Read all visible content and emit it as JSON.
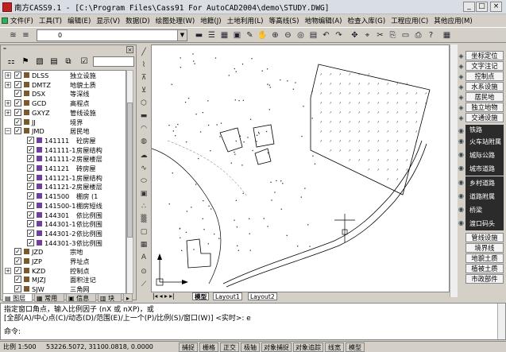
{
  "title": "南方CASS9.1 - [C:\\Program Files\\Cass91 For AutoCAD2004\\demo\\STUDY.DWG]",
  "window_controls": [
    "_",
    "□",
    "×"
  ],
  "menu": [
    "文件(F)",
    "工具(T)",
    "编辑(E)",
    "显示(V)",
    "数据(D)",
    "绘图处理(W)",
    "地籍(J)",
    "土地利用(L)",
    "等高线(S)",
    "地物编辑(A)",
    "检查入库(G)",
    "工程应用(C)",
    "其他应用(M)"
  ],
  "layer_control": {
    "value": "0"
  },
  "tree": [
    {
      "exp": "+",
      "code": "DLSS",
      "name": "独立设施",
      "color": "#7a5a2a"
    },
    {
      "exp": "+",
      "code": "DMTZ",
      "name": "地貌土质",
      "color": "#7a5a2a"
    },
    {
      "exp": "",
      "code": "DSX",
      "name": "等深线",
      "color": "#7a5a2a"
    },
    {
      "exp": "+",
      "code": "GCD",
      "name": "高程点",
      "color": "#7a5a2a"
    },
    {
      "exp": "+",
      "code": "GXYZ",
      "name": "管线设施",
      "color": "#7a5a2a"
    },
    {
      "exp": "",
      "code": "JJ",
      "name": "境界",
      "color": "#7a5a2a"
    },
    {
      "exp": "-",
      "code": "JMD",
      "name": "居民地",
      "color": "#7a5a2a"
    },
    {
      "exp": "",
      "code": "141111",
      "name": "砼房屋",
      "color": "#7040a0",
      "sub": true
    },
    {
      "exp": "",
      "code": "141111-1",
      "name": "房屋结构",
      "color": "#7040a0",
      "sub": true
    },
    {
      "exp": "",
      "code": "141111-2",
      "name": "房屋楼层",
      "color": "#7040a0",
      "sub": true
    },
    {
      "exp": "",
      "code": "141121",
      "name": "砖房屋",
      "color": "#7040a0",
      "sub": true
    },
    {
      "exp": "",
      "code": "141121-1",
      "name": "房屋结构",
      "color": "#7040a0",
      "sub": true
    },
    {
      "exp": "",
      "code": "141121-2",
      "name": "房屋楼层",
      "color": "#7040a0",
      "sub": true
    },
    {
      "exp": "",
      "code": "141500",
      "name": "棚房  (1",
      "color": "#7040a0",
      "sub": true
    },
    {
      "exp": "",
      "code": "141500-1",
      "name": "棚房短线",
      "color": "#7040a0",
      "sub": true
    },
    {
      "exp": "",
      "code": "144301",
      "name": "依比例围",
      "color": "#7040a0",
      "sub": true
    },
    {
      "exp": "",
      "code": "144301-1",
      "name": "依比例围",
      "color": "#7040a0",
      "sub": true
    },
    {
      "exp": "",
      "code": "144301-2",
      "name": "依比例围",
      "color": "#7040a0",
      "sub": true
    },
    {
      "exp": "",
      "code": "144301-3",
      "name": "依比例围",
      "color": "#7040a0",
      "sub": true
    },
    {
      "exp": "",
      "code": "JZD",
      "name": "宗地",
      "color": "#7a5a2a"
    },
    {
      "exp": "",
      "code": "JZP",
      "name": "界址点",
      "color": "#7a5a2a"
    },
    {
      "exp": "+",
      "code": "KZD",
      "name": "控制点",
      "color": "#7a5a2a"
    },
    {
      "exp": "",
      "code": "MJZJ",
      "name": "面积注记",
      "color": "#7a5a2a"
    },
    {
      "exp": "",
      "code": "SJW",
      "name": "三角网",
      "color": "#7a5a2a"
    }
  ],
  "panel_tabs": [
    "图层",
    "常用",
    "信息",
    "块"
  ],
  "layout_tabs": [
    "模型",
    "Layout1",
    "Layout2"
  ],
  "right_panel": {
    "top_buttons": [
      "坐标定位",
      "文字注记",
      "控制点",
      "水系设施",
      "居民地",
      "独立地物",
      "交通设施"
    ],
    "dark_items": [
      "铁路",
      "火车站附属",
      "城际公路",
      "城市道路",
      "乡村道路",
      "道路附属",
      "桥梁",
      "渡口码头"
    ],
    "bottom_buttons": [
      "管线设施",
      "境界线",
      "地貌土质",
      "植被土质",
      "市政部件"
    ]
  },
  "command": {
    "line1": "指定窗口角点，输入比例因子 (nX 或 nXP)，或",
    "line2": "[全部(A)/中心点(C)/动态(D)/范围(E)/上一个(P)/比例(S)/窗口(W)] <实时>: e",
    "prompt": "命令:"
  },
  "status": {
    "scale": "比例 1:500",
    "coords": "53226.5072, 31100.0818, 0.0000",
    "toggles": [
      "捕捉",
      "栅格",
      "正交",
      "极轴",
      "对象捕捉",
      "对象追踪",
      "线宽",
      "模型"
    ]
  },
  "colors": {
    "dark_panel": "#2b2b2b",
    "canvas_bg": "#ffffff"
  }
}
